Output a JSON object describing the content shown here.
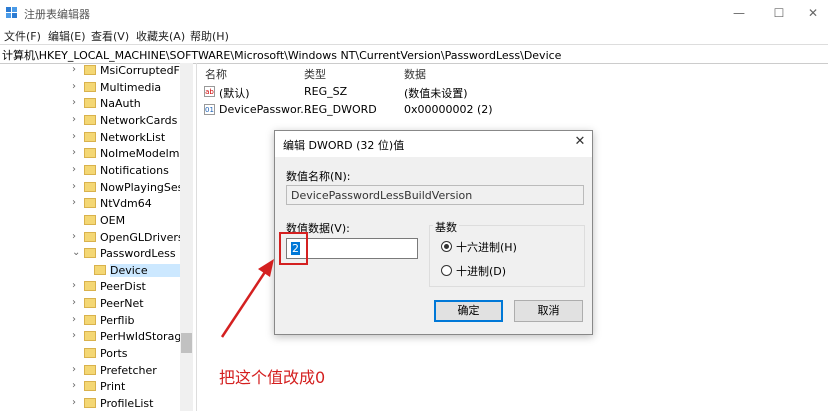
{
  "window": {
    "title": "注册表编辑器",
    "minimize": "—",
    "maximize": "☐",
    "close": "✕"
  },
  "menu": [
    "文件(F)",
    "编辑(E)",
    "查看(V)",
    "收藏夹(A)",
    "帮助(H)"
  ],
  "address": "计算机\\HKEY_LOCAL_MACHINE\\SOFTWARE\\Microsoft\\Windows NT\\CurrentVersion\\PasswordLess\\Device",
  "tree": [
    {
      "label": "MsiCorruptedFileRecovery",
      "chevron": "›"
    },
    {
      "label": "Multimedia",
      "chevron": "›"
    },
    {
      "label": "NaAuth",
      "chevron": "›"
    },
    {
      "label": "NetworkCards",
      "chevron": "›"
    },
    {
      "label": "NetworkList",
      "chevron": "›"
    },
    {
      "label": "NoImeModelmes",
      "chevron": "›"
    },
    {
      "label": "Notifications",
      "chevron": "›"
    },
    {
      "label": "NowPlayingSessionManager",
      "chevron": "›"
    },
    {
      "label": "NtVdm64",
      "chevron": "›"
    },
    {
      "label": "OEM",
      "chevron": ""
    },
    {
      "label": "OpenGLDrivers",
      "chevron": "›"
    },
    {
      "label": "PasswordLess",
      "chevron": "⌄"
    },
    {
      "label": "Device",
      "chevron": "",
      "selected": true,
      "indent": true
    },
    {
      "label": "PeerDist",
      "chevron": "›"
    },
    {
      "label": "PeerNet",
      "chevron": "›"
    },
    {
      "label": "Perflib",
      "chevron": "›"
    },
    {
      "label": "PerHwIdStorage",
      "chevron": "›"
    },
    {
      "label": "Ports",
      "chevron": ""
    },
    {
      "label": "Prefetcher",
      "chevron": "›"
    },
    {
      "label": "Print",
      "chevron": "›"
    },
    {
      "label": "ProfileList",
      "chevron": "›"
    }
  ],
  "list": {
    "headers": {
      "name": "名称",
      "type": "类型",
      "data": "数据"
    },
    "rows": [
      {
        "icon": "ab",
        "name": "(默认)",
        "type": "REG_SZ",
        "data": "(数值未设置)"
      },
      {
        "icon": "01",
        "name": "DevicePasswor...",
        "type": "REG_DWORD",
        "data": "0x00000002 (2)"
      }
    ]
  },
  "dialog": {
    "title": "编辑 DWORD (32 位)值",
    "close": "✕",
    "name_label": "数值名称(N):",
    "name_value": "DevicePasswordLessBuildVersion",
    "data_label": "数值数据(V):",
    "data_value": "2",
    "base_label": "基数",
    "hex_label": "十六进制(H)",
    "dec_label": "十进制(D)",
    "base_selected": "hex",
    "ok": "确定",
    "cancel": "取消"
  },
  "annotation": {
    "text": "把这个值改成0",
    "color": "#d42020"
  },
  "colors": {
    "selection": "#cce8ff",
    "folder": "#f4d774",
    "accent": "#0078d7"
  }
}
